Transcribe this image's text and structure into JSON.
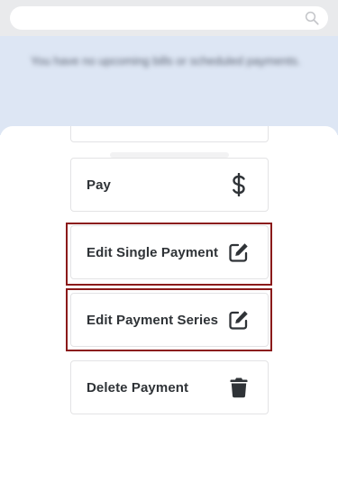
{
  "background": {
    "search": {
      "icon": "search-icon"
    },
    "info_text": "You have no upcoming bills or scheduled payments."
  },
  "sheet": {
    "actions": [
      {
        "label": "Pay",
        "icon": "dollar-icon"
      },
      {
        "label": "Edit Single Payment",
        "icon": "edit-icon"
      },
      {
        "label": "Edit Payment Series",
        "icon": "edit-icon"
      },
      {
        "label": "Delete Payment",
        "icon": "trash-icon"
      }
    ]
  },
  "colors": {
    "highlight": "#8b1a1a",
    "text": "#2f3337",
    "icon": "#2f3337",
    "card_border": "#e3e3e5",
    "info_background": "#dde6f4"
  }
}
